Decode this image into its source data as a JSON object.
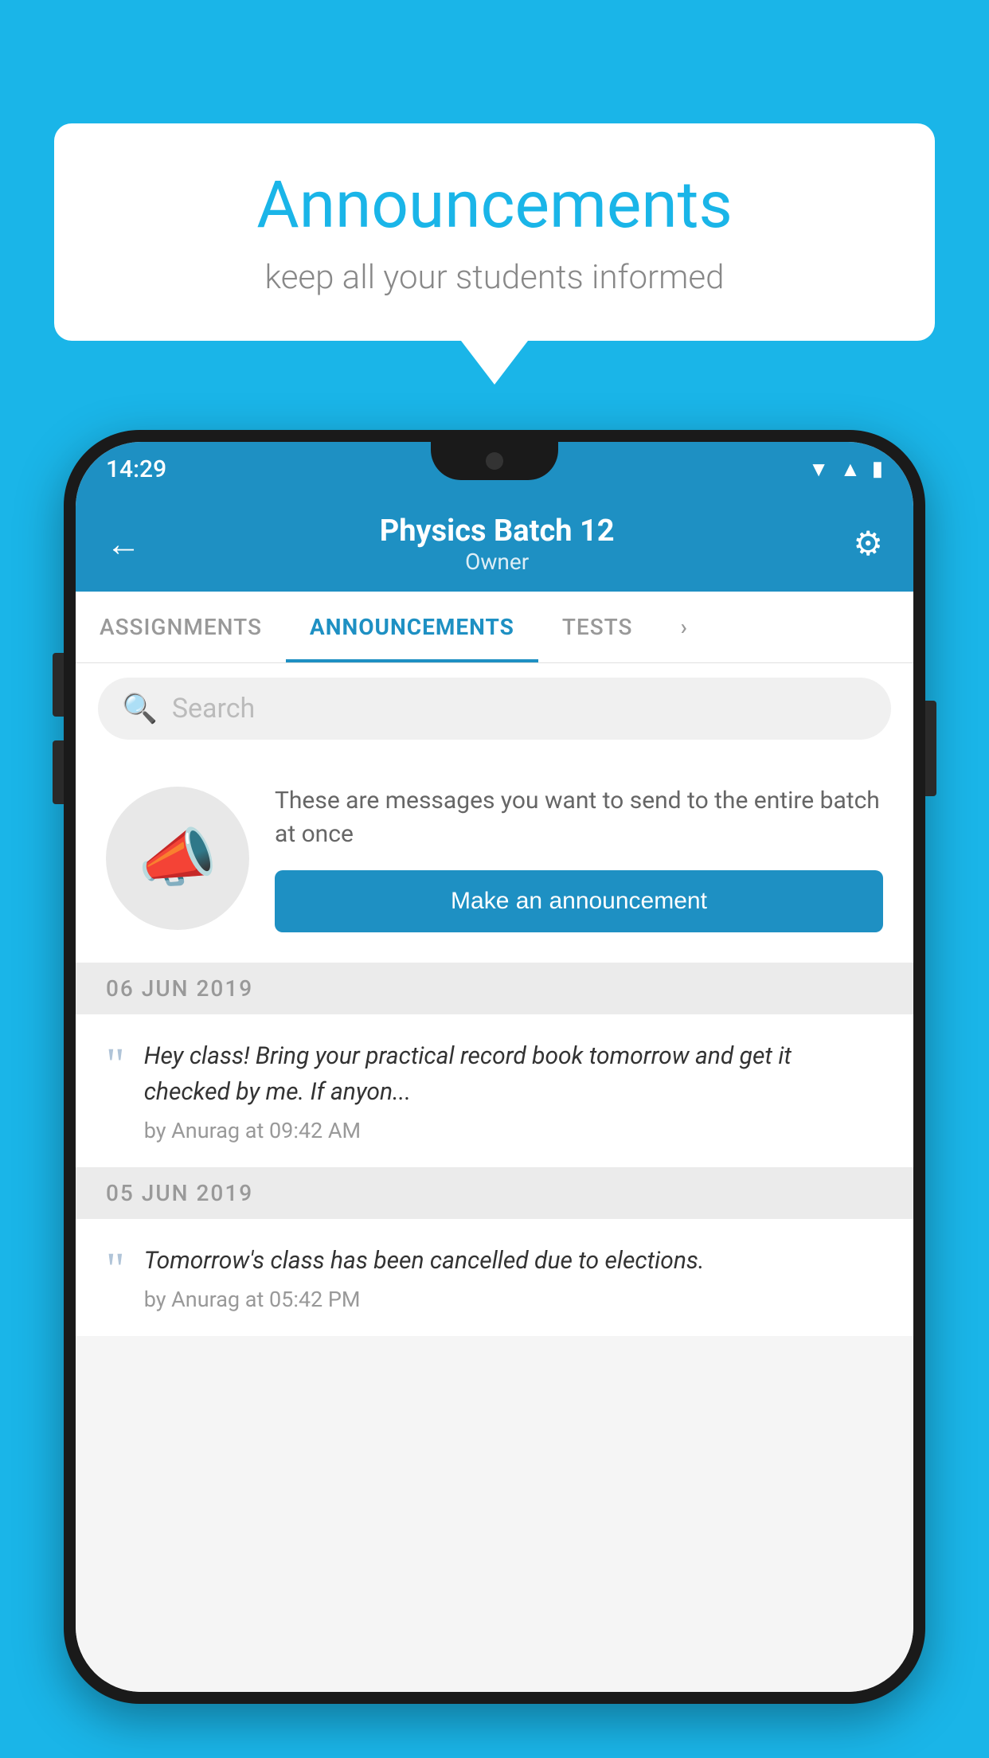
{
  "background_color": "#1ab5e8",
  "speech_bubble": {
    "title": "Announcements",
    "subtitle": "keep all your students informed"
  },
  "phone": {
    "status_bar": {
      "time": "14:29",
      "icons": [
        "wifi",
        "signal",
        "battery"
      ]
    },
    "header": {
      "title": "Physics Batch 12",
      "subtitle": "Owner",
      "back_label": "←",
      "settings_label": "⚙"
    },
    "tabs": [
      {
        "label": "ASSIGNMENTS",
        "active": false
      },
      {
        "label": "ANNOUNCEMENTS",
        "active": true
      },
      {
        "label": "TESTS",
        "active": false
      },
      {
        "label": "...",
        "active": false
      }
    ],
    "search": {
      "placeholder": "Search"
    },
    "announcement_prompt": {
      "description": "These are messages you want to send to the entire batch at once",
      "button_label": "Make an announcement"
    },
    "announcements": [
      {
        "date": "06  JUN  2019",
        "text": "Hey class! Bring your practical record book tomorrow and get it checked by me. If anyon...",
        "meta": "by Anurag at 09:42 AM"
      },
      {
        "date": "05  JUN  2019",
        "text": "Tomorrow's class has been cancelled due to elections.",
        "meta": "by Anurag at 05:42 PM"
      }
    ]
  }
}
